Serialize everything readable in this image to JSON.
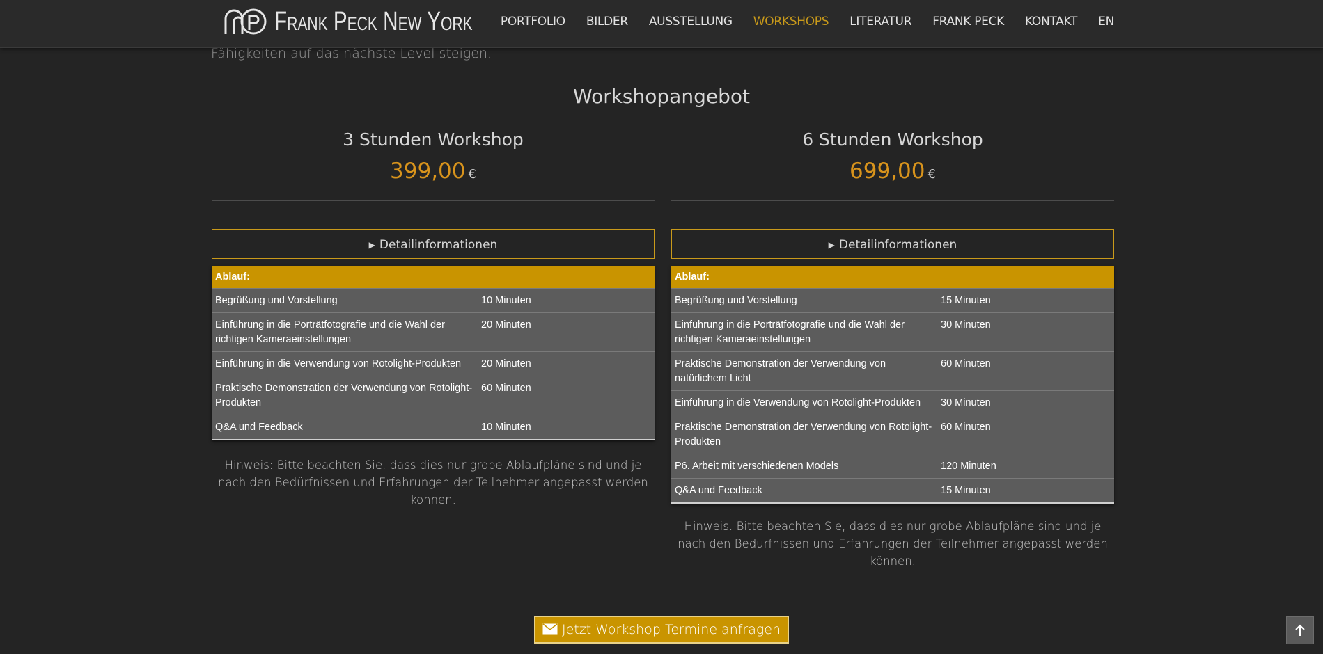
{
  "brand": {
    "logo_text": "Frank Peck New York"
  },
  "nav": {
    "items": [
      {
        "label": "PORTFOLIO",
        "active": false
      },
      {
        "label": "BILDER",
        "active": false
      },
      {
        "label": "AUSSTELLUNG",
        "active": false
      },
      {
        "label": "WORKSHOPS",
        "active": true
      },
      {
        "label": "LITERATUR",
        "active": false
      },
      {
        "label": "FRANK PECK",
        "active": false
      },
      {
        "label": "KONTAKT",
        "active": false
      },
      {
        "label": "EN",
        "active": false
      }
    ]
  },
  "intro_text": "Fähigkeiten auf das nächste Level steigen.",
  "section_title": "Workshopangebot",
  "workshops": [
    {
      "title": "3 Stunden Workshop",
      "price": "399,00",
      "currency": "€",
      "details_label": "Detailinformationen",
      "table_header": "Ablauf:",
      "schedule": [
        {
          "activity": "Begrüßung und Vorstellung",
          "duration": "10 Minuten"
        },
        {
          "activity": "Einführung in die Porträtfotografie und die Wahl der richtigen Kameraeinstellungen",
          "duration": "20 Minuten"
        },
        {
          "activity": "Einführung in die Verwendung von Rotolight-Produkten",
          "duration": "20 Minuten"
        },
        {
          "activity": "Praktische Demonstration der Verwendung von Rotolight-Produkten",
          "duration": "60 Minuten"
        },
        {
          "activity": "Q&A und Feedback",
          "duration": "10 Minuten"
        }
      ],
      "hint": "Hinweis: Bitte beachten Sie, dass dies nur grobe Ablaufpläne sind und je nach den Bedürfnissen und Erfahrungen der Teilnehmer angepasst werden können."
    },
    {
      "title": "6 Stunden Workshop",
      "price": "699,00",
      "currency": "€",
      "details_label": "Detailinformationen",
      "table_header": "Ablauf:",
      "schedule": [
        {
          "activity": "Begrüßung und Vorstellung",
          "duration": "15 Minuten"
        },
        {
          "activity": "Einführung in die Porträtfotografie und die Wahl der richtigen Kameraeinstellungen",
          "duration": "30 Minuten"
        },
        {
          "activity": "Praktische Demonstration der Verwendung von natürlichem Licht",
          "duration": "60 Minuten"
        },
        {
          "activity": "Einführung in die Verwendung von Rotolight-Produkten",
          "duration": "30 Minuten"
        },
        {
          "activity": "Praktische Demonstration der Verwendung von Rotolight-Produkten",
          "duration": "60 Minuten"
        },
        {
          "activity": "P6. Arbeit mit verschiedenen Models",
          "duration": "120 Minuten"
        },
        {
          "activity": "Q&A und Feedback",
          "duration": "15 Minuten"
        }
      ],
      "hint": "Hinweis: Bitte beachten Sie, dass dies nur grobe Ablaufpläne sind und je nach den Bedürfnissen und Erfahrungen der Teilnehmer angepasst werden können."
    }
  ],
  "cta": {
    "label": "Jetzt Workshop Termine anfragen",
    "icon": "envelope-icon"
  },
  "scroll_top": {
    "icon": "arrow-up-icon"
  },
  "colors": {
    "accent": "#c99a1a",
    "price": "#d9941c",
    "table_header": "#c99400",
    "table_row": "#5c5c5c",
    "background": "#242424"
  }
}
